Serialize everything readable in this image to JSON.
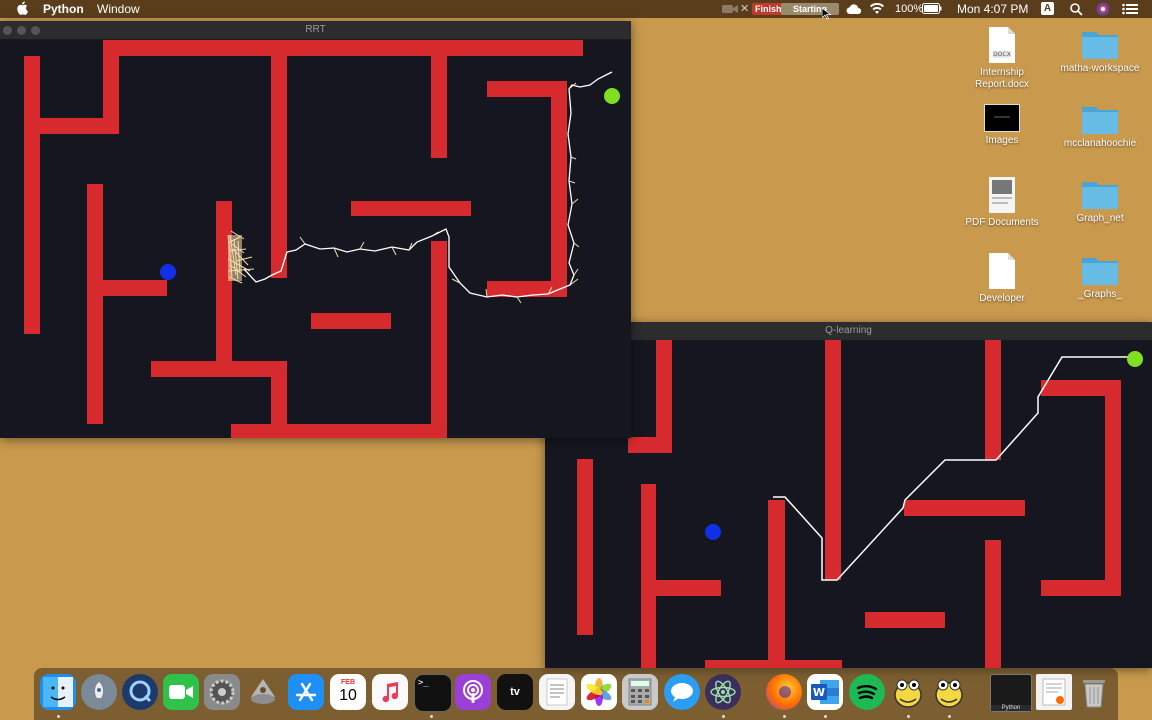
{
  "menubar": {
    "app_name": "Python",
    "menu_window": "Window",
    "finish_label": "Finish",
    "starting_label": "Starting",
    "battery": "100%",
    "clock": "Mon 4:07 PM",
    "keyboard": "A"
  },
  "rrt_window": {
    "title": "RRT"
  },
  "q_window": {
    "title": "Q-learning"
  },
  "desktop": {
    "items": [
      {
        "label": "Internship Report.docx",
        "icon": "docx-file-icon"
      },
      {
        "label": "matha-workspace",
        "icon": "folder-icon"
      },
      {
        "label": "Images",
        "icon": "terminal-thumbnail-icon"
      },
      {
        "label": "mcclanahoochie",
        "icon": "folder-icon"
      },
      {
        "label": "PDF Documents",
        "icon": "pdf-file-icon"
      },
      {
        "label": "Graph_net",
        "icon": "folder-icon"
      },
      {
        "label": "Developer",
        "icon": "file-icon"
      },
      {
        "label": "_Graphs_",
        "icon": "folder-icon"
      }
    ]
  },
  "dock": {
    "calendar_month": "FEB",
    "calendar_day": "10",
    "tv_label": "tv",
    "python_label": "Python",
    "items": [
      "finder",
      "launchpad",
      "quicktime",
      "facetime",
      "system-preferences",
      "script-editor",
      "app-store",
      "calendar",
      "music",
      "terminal",
      "podcasts",
      "apple-tv",
      "textedit",
      "photos",
      "calculator",
      "messages",
      "atom",
      "firefox",
      "word",
      "spotify",
      "python-launcher",
      "python-launcher-2",
      "python-window",
      "document",
      "trash"
    ]
  },
  "colors": {
    "wall": "#d72a2f",
    "floor": "#15161f",
    "start": "#1030e8",
    "goal": "#7ee020",
    "path": "#ffffff",
    "tree": "#f6deaa",
    "desktop": "#c99a4e"
  }
}
